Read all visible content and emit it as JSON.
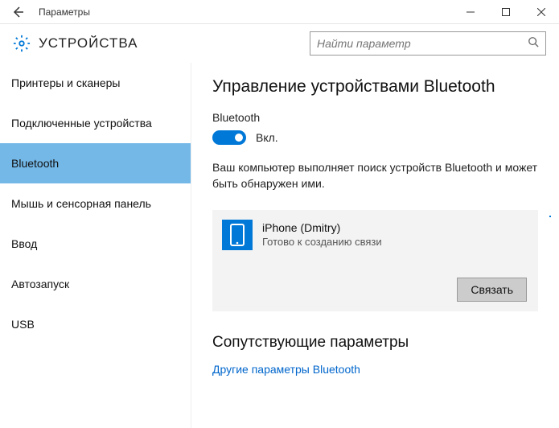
{
  "window": {
    "title": "Параметры"
  },
  "header": {
    "section": "УСТРОЙСТВА",
    "search_placeholder": "Найти параметр"
  },
  "sidebar": {
    "items": [
      {
        "label": "Принтеры и сканеры"
      },
      {
        "label": "Подключенные устройства"
      },
      {
        "label": "Bluetooth"
      },
      {
        "label": "Мышь и сенсорная панель"
      },
      {
        "label": "Ввод"
      },
      {
        "label": "Автозапуск"
      },
      {
        "label": "USB"
      }
    ]
  },
  "main": {
    "title": "Управление устройствами Bluetooth",
    "toggle_label": "Bluetooth",
    "toggle_state": "Вкл.",
    "description": "Ваш компьютер выполняет поиск устройств Bluetooth и может быть обнаружен ими.",
    "device": {
      "name": "iPhone (Dmitry)",
      "status": "Готово к созданию связи",
      "pair_button": "Связать"
    },
    "related_heading": "Сопутствующие параметры",
    "related_link": "Другие параметры Bluetooth"
  }
}
